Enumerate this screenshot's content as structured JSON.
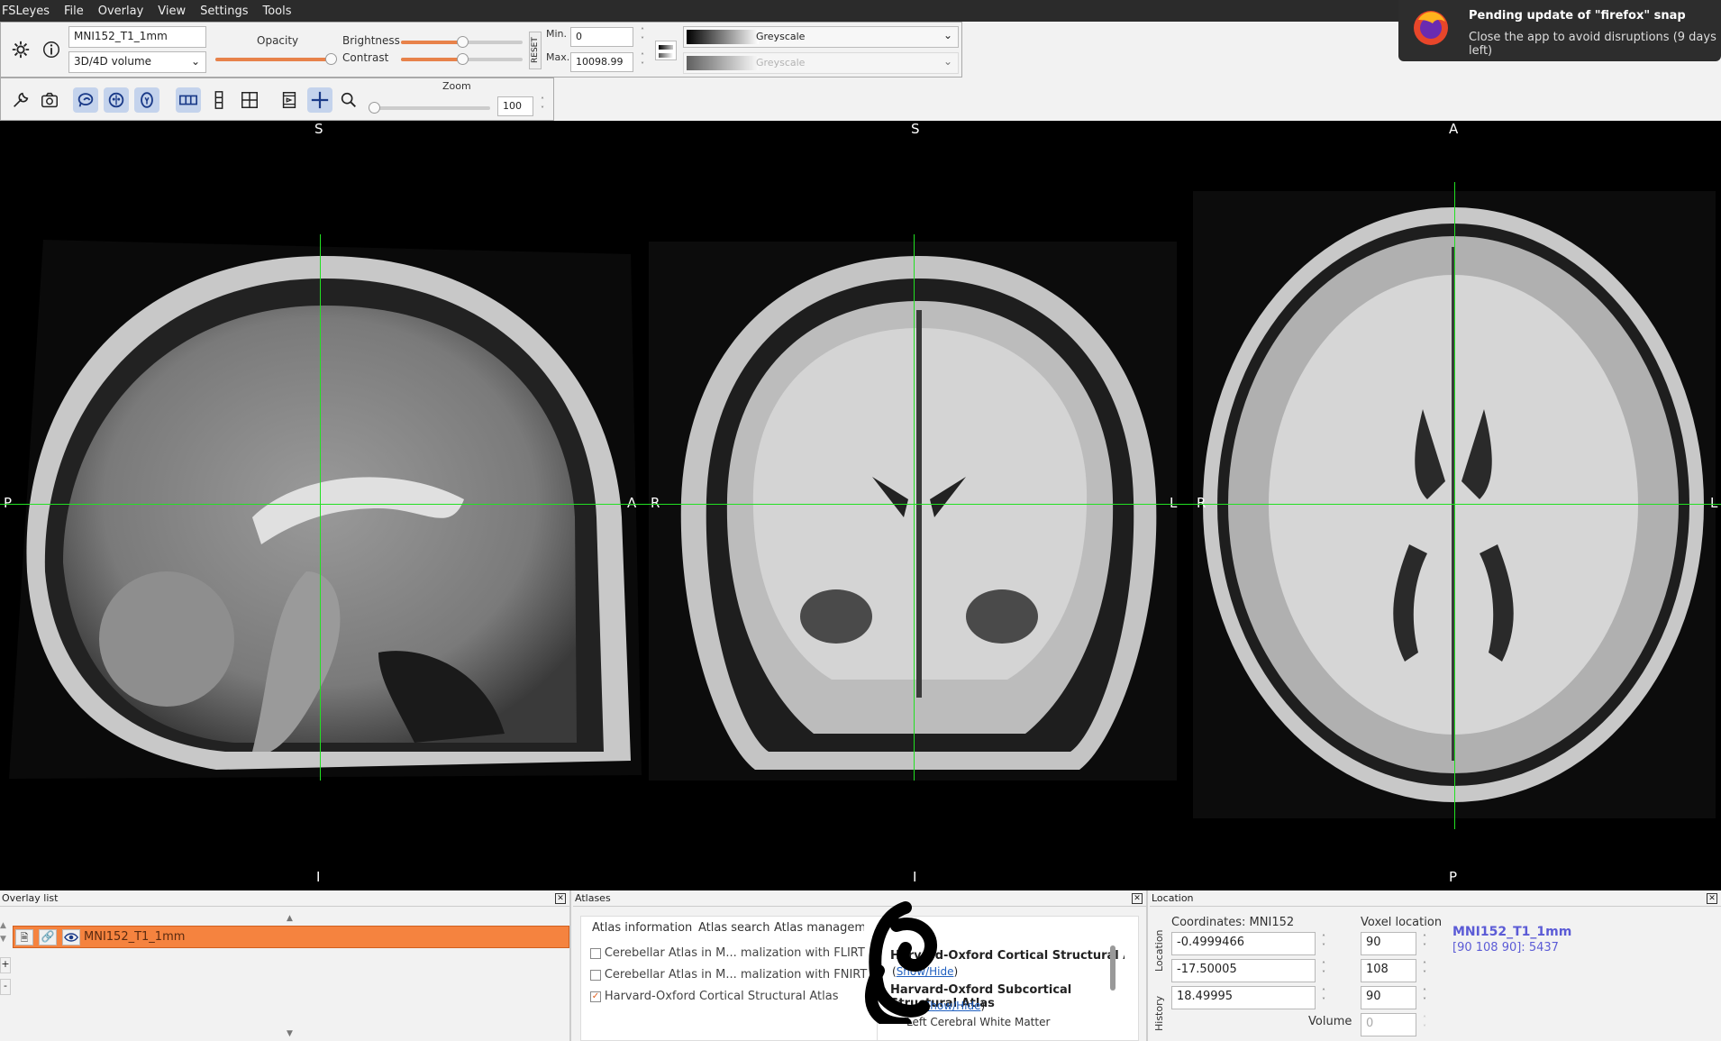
{
  "menu": [
    "FSLeyes",
    "File",
    "Overlay",
    "View",
    "Settings",
    "Tools"
  ],
  "overlay_toolbar": {
    "overlay_name": "MNI152_T1_1mm",
    "overlay_type": "3D/4D volume",
    "opacity_label": "Opacity",
    "brightness_label": "Brightness",
    "contrast_label": "Contrast",
    "reset_label": "RESET",
    "min_label": "Min.",
    "max_label": "Max.",
    "min_value": "0",
    "max_value": "10098.99",
    "colormap": "Greyscale",
    "neg_colormap": "Greyscale",
    "opacity": 0.95,
    "brightness": 0.5,
    "contrast": 0.5
  },
  "ortho_toolbar": {
    "zoom_label": "Zoom",
    "zoom_value": "100"
  },
  "views": {
    "sagittal": {
      "top": "S",
      "bottom": "I",
      "left": "P",
      "right": "A"
    },
    "coronal": {
      "top": "S",
      "bottom": "I",
      "left": "R",
      "right": "L"
    },
    "axial": {
      "top": "A",
      "bottom": "P",
      "left": "R",
      "right": "L"
    }
  },
  "overlay_list": {
    "title": "Overlay list",
    "items": [
      "MNI152_T1_1mm"
    ]
  },
  "atlases": {
    "title": "Atlases",
    "tabs": [
      "Atlas information",
      "Atlas search",
      "Atlas manageme"
    ],
    "list": [
      {
        "label": "Cerebellar Atlas in M... malization with FLIRT",
        "checked": false
      },
      {
        "label": "Cerebellar Atlas in M... malization with FNIRT",
        "checked": false
      },
      {
        "label": "Harvard-Oxford Cortical Structural Atlas",
        "checked": true
      }
    ],
    "info": [
      {
        "title": "Harvard-Oxford Cortical Structural Atlas",
        "link": "Show/Hide"
      },
      {
        "title": "Harvard-Oxford Subcortical Structural Atlas",
        "link": "Show/Hide"
      }
    ],
    "info_more": "Left Cerebral White Matter"
  },
  "location": {
    "title": "Location",
    "coord_label": "Coordinates: MNI152",
    "voxel_label": "Voxel location",
    "side_tabs": [
      "Location",
      "History"
    ],
    "coords": [
      "-0.4999466",
      "-17.50005",
      "18.49995"
    ],
    "voxels": [
      "90",
      "108",
      "90"
    ],
    "volume_label": "Volume",
    "volume_value": "0",
    "overlay_name": "MNI152_T1_1mm",
    "overlay_value": "[90 108 90]: 5437"
  },
  "notification": {
    "title": "Pending update of \"firefox\" snap",
    "body": "Close the app to avoid disruptions (9 days left)"
  },
  "colors": {
    "accent": "#f47b33",
    "cursor": "#22e022",
    "link": "#5b5bd6"
  }
}
